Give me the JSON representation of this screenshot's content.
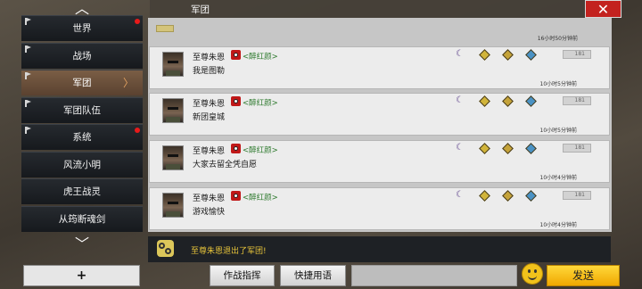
{
  "header": {
    "title": "军团",
    "close_icon": "close-icon"
  },
  "channels": [
    {
      "label": "世界",
      "unread": true,
      "active": false
    },
    {
      "label": "战场",
      "unread": false,
      "active": false
    },
    {
      "label": "军团",
      "unread": false,
      "active": true
    },
    {
      "label": "军团队伍",
      "unread": false,
      "active": false
    },
    {
      "label": "系统",
      "unread": true,
      "active": false
    },
    {
      "label": "风流小明",
      "unread": false,
      "active": false
    },
    {
      "label": "虎王战灵",
      "unread": false,
      "active": false
    },
    {
      "label": "从筠断魂剑",
      "unread": false,
      "active": false
    }
  ],
  "add_button_label": "+",
  "chat": {
    "top_time": "16小时50分钟前",
    "messages": [
      {
        "sender": "至尊朱恩",
        "guild": "<醉红颜>",
        "text": "我是图勒",
        "time": "10小时5分钟前",
        "likes": "181"
      },
      {
        "sender": "至尊朱恩",
        "guild": "<醉红颜>",
        "text": "新团皇城",
        "time": "10小时5分钟前",
        "likes": "181"
      },
      {
        "sender": "至尊朱恩",
        "guild": "<醉红颜>",
        "text": "大家去留全凭自愿",
        "time": "10小时4分钟前",
        "likes": "181"
      },
      {
        "sender": "至尊朱恩",
        "guild": "<醉红颜>",
        "text": "游戏愉快",
        "time": "10小时4分钟前",
        "likes": "181"
      }
    ]
  },
  "notification": {
    "text": "至尊朱恩退出了军团!"
  },
  "bottom": {
    "cmd1": "作战指挥",
    "cmd2": "快捷用语",
    "input_value": "",
    "send_label": "发送"
  },
  "colors": {
    "guild_name": "#2e7a2e",
    "notice": "#e8c53a",
    "send": "#f0a800",
    "close": "#c3221f"
  }
}
